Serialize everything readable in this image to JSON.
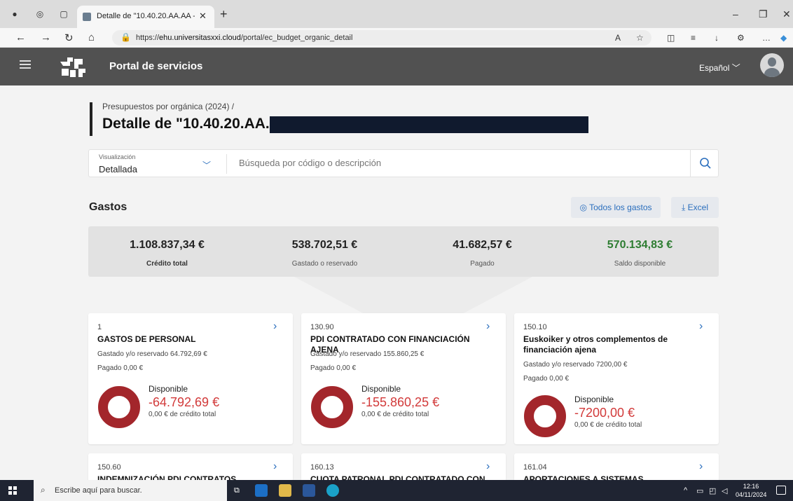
{
  "browser": {
    "tab_title": "Detalle de \"10.40.20.AA.AA - H20",
    "url_prefix": "https://",
    "url_host": "ehu.universitasxxi.cloud",
    "url_path": "/portal/ec_budget_organic_detail"
  },
  "header": {
    "app_title": "Portal de servicios",
    "language": "Español"
  },
  "page": {
    "breadcrumb": "Presupuestos por orgánica (2024)  /",
    "title": "Detalle de \"10.40.20.AA.AA -"
  },
  "search": {
    "visualization_label": "Visualización",
    "visualization_value": "Detallada",
    "placeholder": "Búsqueda por código o descripción"
  },
  "gastos": {
    "title": "Gastos",
    "all_expenses_label": "Todos los gastos",
    "excel_label": "Excel"
  },
  "summary": [
    {
      "value": "1.108.837,34 €",
      "label": "Crédito total"
    },
    {
      "value": "538.702,51 €",
      "label": "Gastado o reservado"
    },
    {
      "value": "41.682,57 €",
      "label": "Pagado"
    },
    {
      "value": "570.134,83 €",
      "label": "Saldo disponible"
    }
  ],
  "cards": [
    {
      "code": "1",
      "name": "GASTOS DE PERSONAL",
      "spent": "Gastado y/o reservado 64.792,69 €",
      "paid": "Pagado 0,00 €",
      "available_label": "Disponible",
      "available": "-64.792,69 €",
      "credit": "0,00 € de crédito total"
    },
    {
      "code": "130.90",
      "name": "PDI CONTRATADO CON FINANCIACIÓN AJENA",
      "spent": "Gastado y/o reservado 155.860,25 €",
      "paid": "Pagado 0,00 €",
      "available_label": "Disponible",
      "available": "-155.860,25 €",
      "credit": "0,00 € de crédito total"
    },
    {
      "code": "150.10",
      "name": "Euskoiker y otros complementos de financiación ajena",
      "spent": "Gastado y/o reservado 7200,00 €",
      "paid": "Pagado 0,00 €",
      "available_label": "Disponible",
      "available": "-7200,00 €",
      "credit": "0,00 € de crédito total"
    },
    {
      "code": "150.60",
      "name": "INDEMNIZACIÓN PDI CONTRATOS"
    },
    {
      "code": "160.13",
      "name": "CUOTA PATRONAL PDI CONTRATADO CON"
    },
    {
      "code": "161.04",
      "name": "APORTACIONES A SISTEMAS"
    }
  ],
  "taskbar": {
    "search_placeholder": "Escribe aquí para buscar.",
    "time": "12:16",
    "date": "04/11/2024"
  },
  "colors": {
    "header_bg": "#515151",
    "accent_blue": "#2a6ebd",
    "positive_green": "#2e7d32",
    "negative_red": "#d23a3a",
    "donut": "#a3262b"
  }
}
